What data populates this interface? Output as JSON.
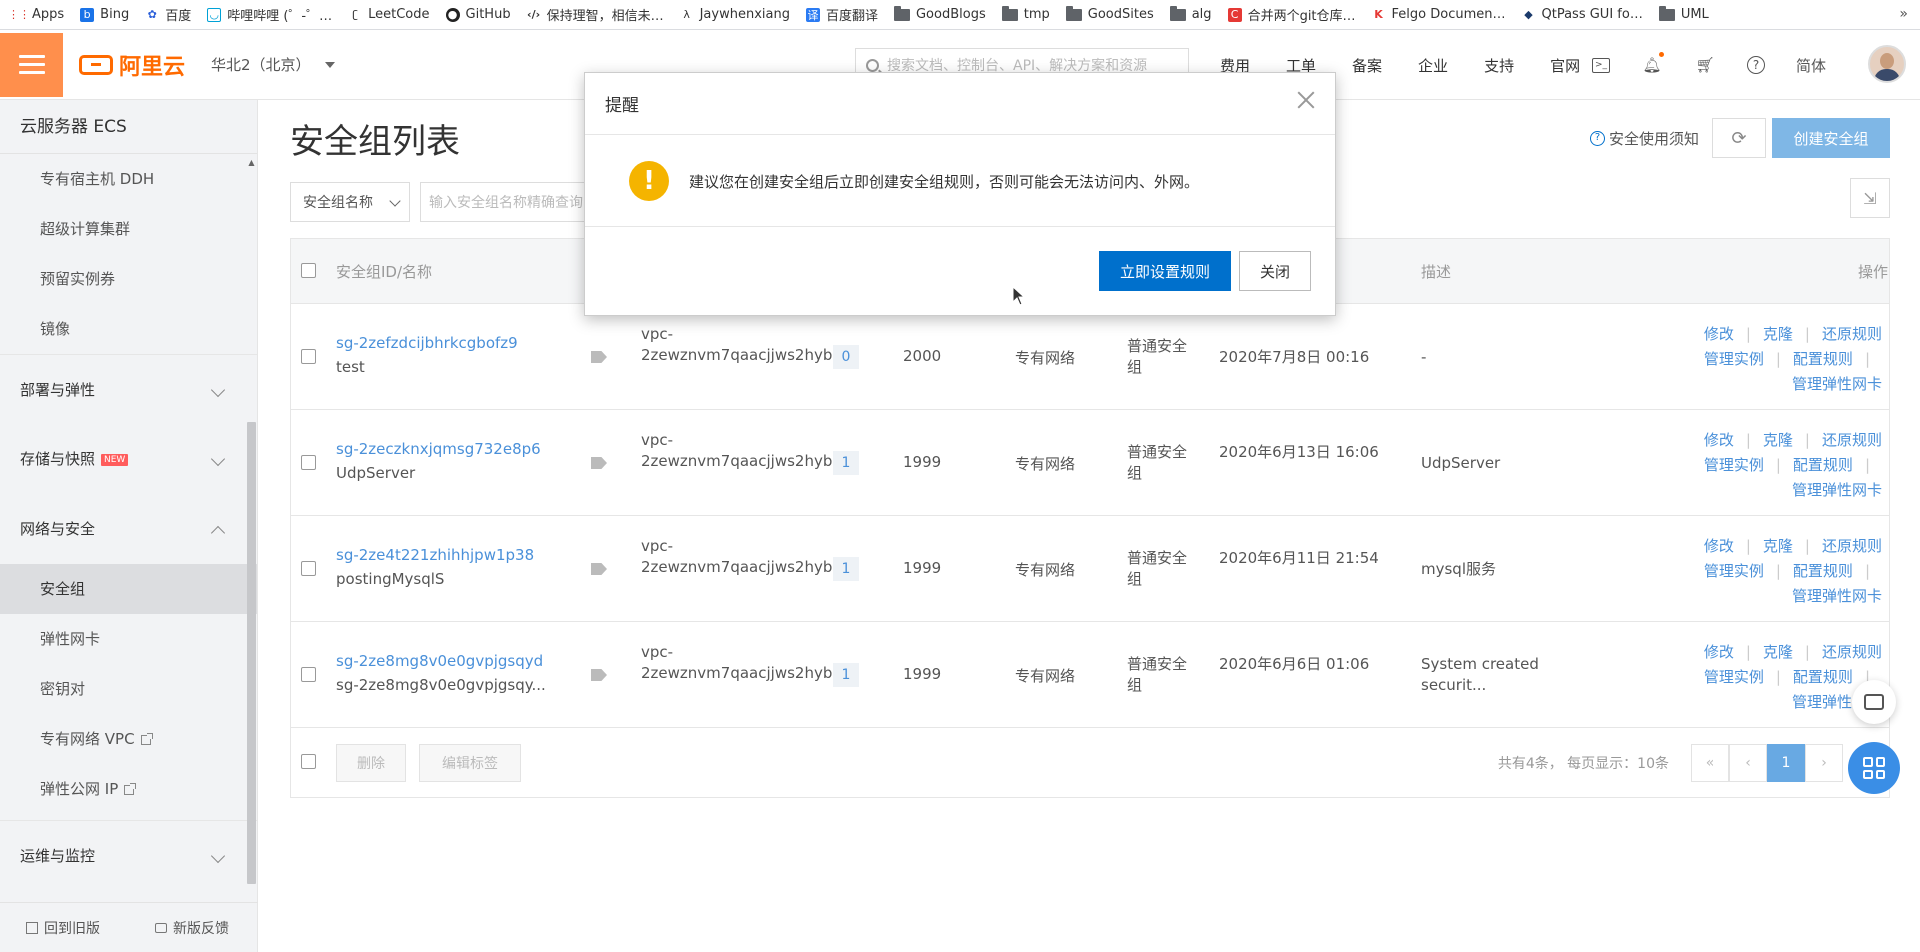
{
  "bookmarks": [
    {
      "label": "Apps",
      "icon": "apps-grid-icon"
    },
    {
      "label": "Bing",
      "icon": "bing-icon"
    },
    {
      "label": "百度",
      "icon": "baidu-icon"
    },
    {
      "label": "哔哩哔哩 (゜-゜…",
      "icon": "bilibili-icon"
    },
    {
      "label": "LeetCode",
      "icon": "leetcode-icon"
    },
    {
      "label": "GitHub",
      "icon": "github-icon"
    },
    {
      "label": "保持理智，相信未…",
      "icon": "code-icon"
    },
    {
      "label": "Jaywhenxiang",
      "icon": "lambda-icon"
    },
    {
      "label": "百度翻译",
      "icon": "translate-icon"
    },
    {
      "label": "GoodBlogs",
      "icon": "folder-icon"
    },
    {
      "label": "tmp",
      "icon": "folder-icon"
    },
    {
      "label": "GoodSites",
      "icon": "folder-icon"
    },
    {
      "label": "alg",
      "icon": "folder-icon"
    },
    {
      "label": "合并两个git仓库…",
      "icon": "csdn-icon"
    },
    {
      "label": "Felgo Documen…",
      "icon": "felgo-icon"
    },
    {
      "label": "QtPass GUI fo…",
      "icon": "qtpass-icon"
    },
    {
      "label": "UML",
      "icon": "folder-icon"
    }
  ],
  "bookmarks_more": "»",
  "header": {
    "logo_text": "阿里云",
    "region": "华北2（北京）",
    "search_placeholder": "搜索文档、控制台、API、解决方案和资源",
    "links": [
      "费用",
      "工单",
      "备案",
      "企业",
      "支持",
      "官网"
    ],
    "lang": "简体"
  },
  "sidebar": {
    "title": "云服务器 ECS",
    "items_top": [
      "专有宿主机 DDH",
      "超级计算集群",
      "预留实例券",
      "镜像"
    ],
    "groups": [
      {
        "label": "部署与弹性",
        "badge": ""
      },
      {
        "label": "存储与快照",
        "badge": "NEW"
      },
      {
        "label": "网络与安全",
        "badge": ""
      }
    ],
    "network_items": [
      "安全组",
      "弹性网卡",
      "密钥对",
      "专有网络 VPC",
      "弹性公网 IP"
    ],
    "last_group": "运维与监控",
    "footer": {
      "back_old": "回到旧版",
      "feedback": "新版反馈"
    }
  },
  "main": {
    "title": "安全组列表",
    "safety_link": "安全使用须知",
    "create_button": "创建安全组",
    "filter_select": "安全组名称",
    "filter_placeholder": "输入安全组名称精确查询",
    "columns": {
      "id_name": "安全组ID/名称",
      "desc": "描述",
      "ops": "操作"
    },
    "rows": [
      {
        "id": "sg-2zefzdcijbhrkcgbofz9",
        "name": "test",
        "vpc": "vpc-2zewznvm7qaacjjws2hyb",
        "count": "0",
        "priority": "2000",
        "net": "专有网络",
        "type": "普通安全组",
        "time": "2020年7月8日 00:16",
        "desc": "-"
      },
      {
        "id": "sg-2zeczknxjqmsg732e8p6",
        "name": "UdpServer",
        "vpc": "vpc-2zewznvm7qaacjjws2hyb",
        "count": "1",
        "priority": "1999",
        "net": "专有网络",
        "type": "普通安全组",
        "time": "2020年6月13日 16:06",
        "desc": "UdpServer"
      },
      {
        "id": "sg-2ze4t221zhihhjpw1p38",
        "name": "postingMysqlS",
        "vpc": "vpc-2zewznvm7qaacjjws2hyb",
        "count": "1",
        "priority": "1999",
        "net": "专有网络",
        "type": "普通安全组",
        "time": "2020年6月11日 21:54",
        "desc": "mysql服务"
      },
      {
        "id": "sg-2ze8mg8v0e0gvpjgsqyd",
        "name": "sg-2ze8mg8v0e0gvpjgsqy...",
        "vpc": "vpc-2zewznvm7qaacjjws2hyb",
        "count": "1",
        "priority": "1999",
        "net": "专有网络",
        "type": "普通安全组",
        "time": "2020年6月6日 01:06",
        "desc": "System created securit..."
      }
    ],
    "row_ops": {
      "edit": "修改",
      "clone": "克隆",
      "restore": "还原规则",
      "manage_instances": "管理实例",
      "config_rules": "配置规则",
      "manage_eni": "管理弹性网卡"
    },
    "footer": {
      "delete": "删除",
      "edit_tags": "编辑标签",
      "summary": "共有4条， 每页显示：10条",
      "pager": {
        "first": "«",
        "prev": "‹",
        "current": "1",
        "next": "›"
      }
    }
  },
  "dialog": {
    "title": "提醒",
    "message": "建议您在创建安全组后立即创建安全组规则，否则可能会无法访问内、外网。",
    "primary_button": "立即设置规则",
    "close_button": "关闭"
  },
  "colors": {
    "brand_orange": "#ff6a00",
    "primary_blue": "#0070cc",
    "link_blue": "#4a90d9",
    "warning": "#f5b400"
  }
}
